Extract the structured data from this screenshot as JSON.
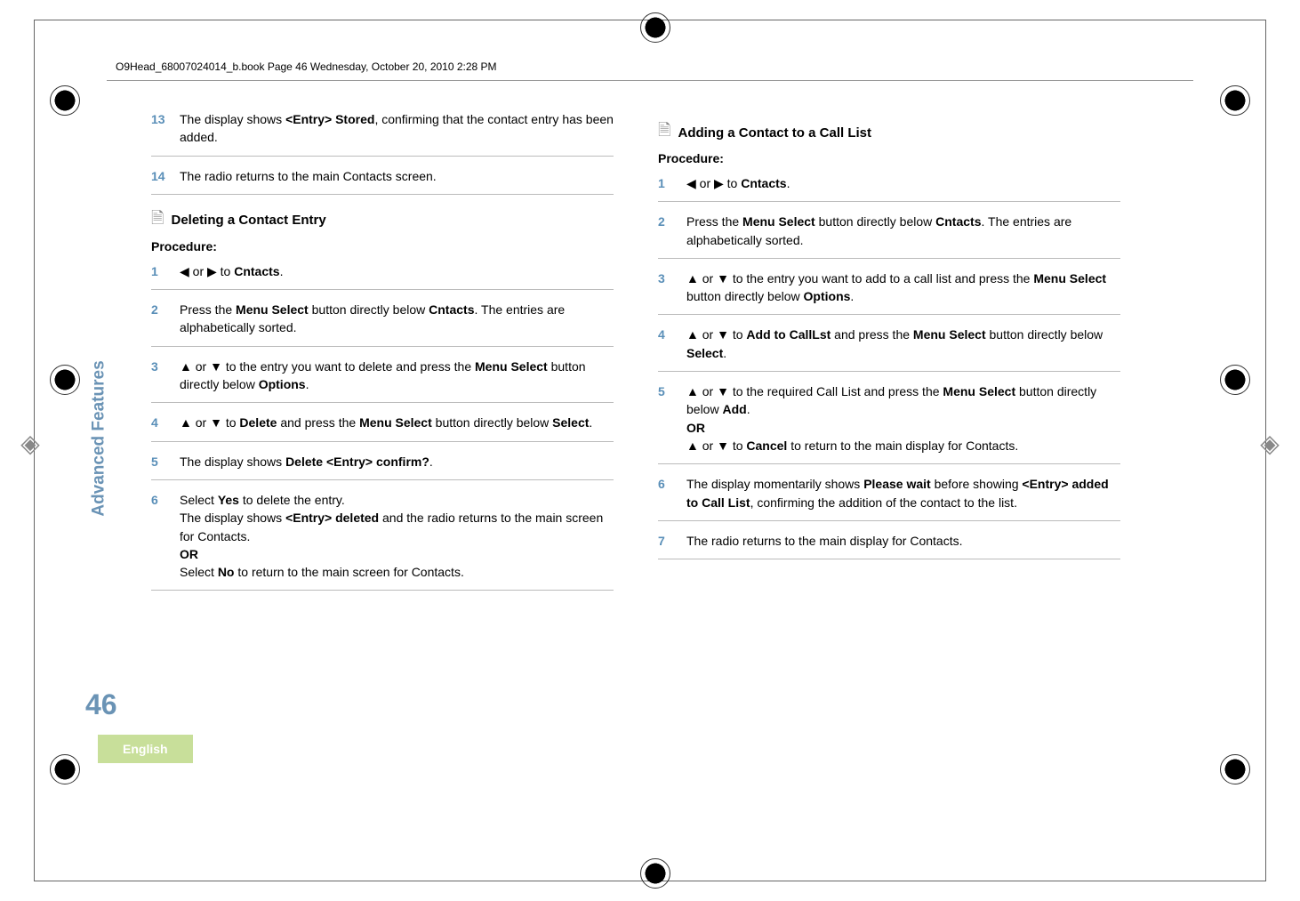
{
  "header": {
    "text": "O9Head_68007024014_b.book  Page 46  Wednesday, October 20, 2010  2:28 PM"
  },
  "sidebar": {
    "label": "Advanced Features"
  },
  "page_number": "46",
  "language": "English",
  "left_col": {
    "steps_top": [
      {
        "num": "13",
        "body_prefix": "The display shows ",
        "body_bold": "<Entry> Stored",
        "body_suffix": ", confirming that the contact entry has been added."
      },
      {
        "num": "14",
        "body_prefix": "The radio returns to the main Contacts screen.",
        "body_bold": "",
        "body_suffix": ""
      }
    ],
    "section1": {
      "title": "Deleting a Contact Entry",
      "procedure": "Procedure:",
      "steps": [
        {
          "num": "1",
          "html": "◀ or ▶ to <b>Cntacts</b>."
        },
        {
          "num": "2",
          "html": "Press the <b>Menu Select</b> button directly below <b>Cntacts</b>. The entries are alphabetically sorted."
        },
        {
          "num": "3",
          "html": "▲ or ▼ to the entry you want to delete and press the <b>Menu Select</b> button directly below <b>Options</b>."
        },
        {
          "num": "4",
          "html": "▲ or ▼ to <b>Delete</b> and press the <b>Menu Select</b> button directly below <b>Select</b>."
        },
        {
          "num": "5",
          "html": "The display shows <b>Delete &lt;Entry&gt; confirm?</b>."
        },
        {
          "num": "6",
          "html": "Select <b>Yes</b> to delete the entry.<br>The display shows <b>&lt;Entry&gt; deleted</b> and the radio returns to the main screen for Contacts.<br><b>OR</b><br>Select <b>No</b> to return to the main screen for Contacts."
        }
      ]
    }
  },
  "right_col": {
    "section1": {
      "title": "Adding a Contact to a Call List",
      "procedure": "Procedure:",
      "steps": [
        {
          "num": "1",
          "html": "◀ or ▶ to <b>Cntacts</b>."
        },
        {
          "num": "2",
          "html": "Press the <b>Menu Select</b> button directly below <b>Cntacts</b>. The entries are alphabetically sorted."
        },
        {
          "num": "3",
          "html": "▲ or ▼ to the entry you want to add to a call list and press the <b>Menu Select</b> button directly below <b>Options</b>."
        },
        {
          "num": "4",
          "html": "▲ or ▼ to <b>Add to CallLst</b> and press the <b>Menu Select</b> button directly below <b>Select</b>."
        },
        {
          "num": "5",
          "html": "▲ or ▼ to the required Call List and press the <b>Menu Select</b> button directly below <b>Add</b>.<br><b>OR</b><br>▲ or ▼ to <b>Cancel</b> to return to the main display for Contacts."
        },
        {
          "num": "6",
          "html": "The display momentarily shows <b>Please wait</b> before showing <b>&lt;Entry&gt; added to Call List</b>, confirming the addition of the contact to the list."
        },
        {
          "num": "7",
          "html": "The radio returns to the main display for Contacts."
        }
      ]
    }
  }
}
